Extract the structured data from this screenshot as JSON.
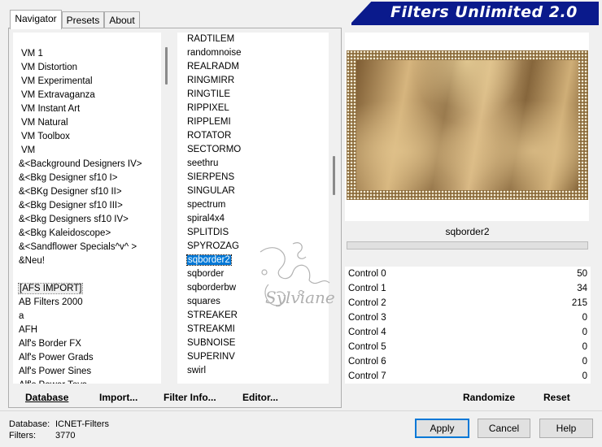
{
  "app": {
    "title": "Filters Unlimited 2.0"
  },
  "tabs": [
    {
      "label": "Navigator",
      "active": true
    },
    {
      "label": "Presets",
      "active": false
    },
    {
      "label": "About",
      "active": false
    }
  ],
  "categories": [
    "VM 1",
    "VM Distortion",
    "VM Experimental",
    "VM Extravaganza",
    "VM Instant Art",
    "VM Natural",
    "VM Toolbox",
    "VM",
    "&<Background Designers IV>",
    "&<Bkg Designer sf10 I>",
    "&<BKg Designer sf10 II>",
    "&<Bkg Designer sf10 III>",
    "&<Bkg Designers sf10 IV>",
    "&<Bkg Kaleidoscope>",
    "&<Sandflower Specials^v^ >",
    "&Neu!",
    "",
    "[AFS IMPORT]",
    "AB Filters 2000",
    "a",
    "AFH",
    "Alf's Border FX",
    "Alf's Power Grads",
    "Alf's Power Sines",
    "Alf's Power Toys"
  ],
  "filters": [
    "RADTILEM",
    "randomnoise",
    "REALRADM",
    "RINGMIRR",
    "RINGTILE",
    "RIPPIXEL",
    "RIPPLEMI",
    "ROTATOR",
    "SECTORMO",
    "seethru",
    "SIERPENS",
    "SINGULAR",
    "spectrum",
    "spiral4x4",
    "SPLITDIS",
    "SPYROZAG",
    "sqborder2",
    "sqborder",
    "sqborderbw",
    "squares",
    "STREAKER",
    "STREAKMI",
    "SUBNOISE",
    "SUPERINV",
    "swirl"
  ],
  "selected_filter": "sqborder2",
  "preview": {
    "filter_name": "sqborder2"
  },
  "controls": [
    {
      "label": "Control 0",
      "value": "50"
    },
    {
      "label": "Control 1",
      "value": "34"
    },
    {
      "label": "Control 2",
      "value": "215"
    },
    {
      "label": "Control 3",
      "value": "0"
    },
    {
      "label": "Control 4",
      "value": "0"
    },
    {
      "label": "Control 5",
      "value": "0"
    },
    {
      "label": "Control 6",
      "value": "0"
    },
    {
      "label": "Control 7",
      "value": "0"
    }
  ],
  "toolbar": {
    "database": "Database",
    "import": "Import...",
    "filter_info": "Filter Info...",
    "editor": "Editor...",
    "randomize": "Randomize",
    "reset": "Reset"
  },
  "status": {
    "database_label": "Database:",
    "database_value": "ICNET-Filters",
    "filters_label": "Filters:",
    "filters_value": "3770"
  },
  "buttons": {
    "apply": "Apply",
    "cancel": "Cancel",
    "help": "Help"
  },
  "watermark": "Sylviane",
  "colors": {
    "banner": "#0a1a8c",
    "selection": "#0078d7"
  }
}
